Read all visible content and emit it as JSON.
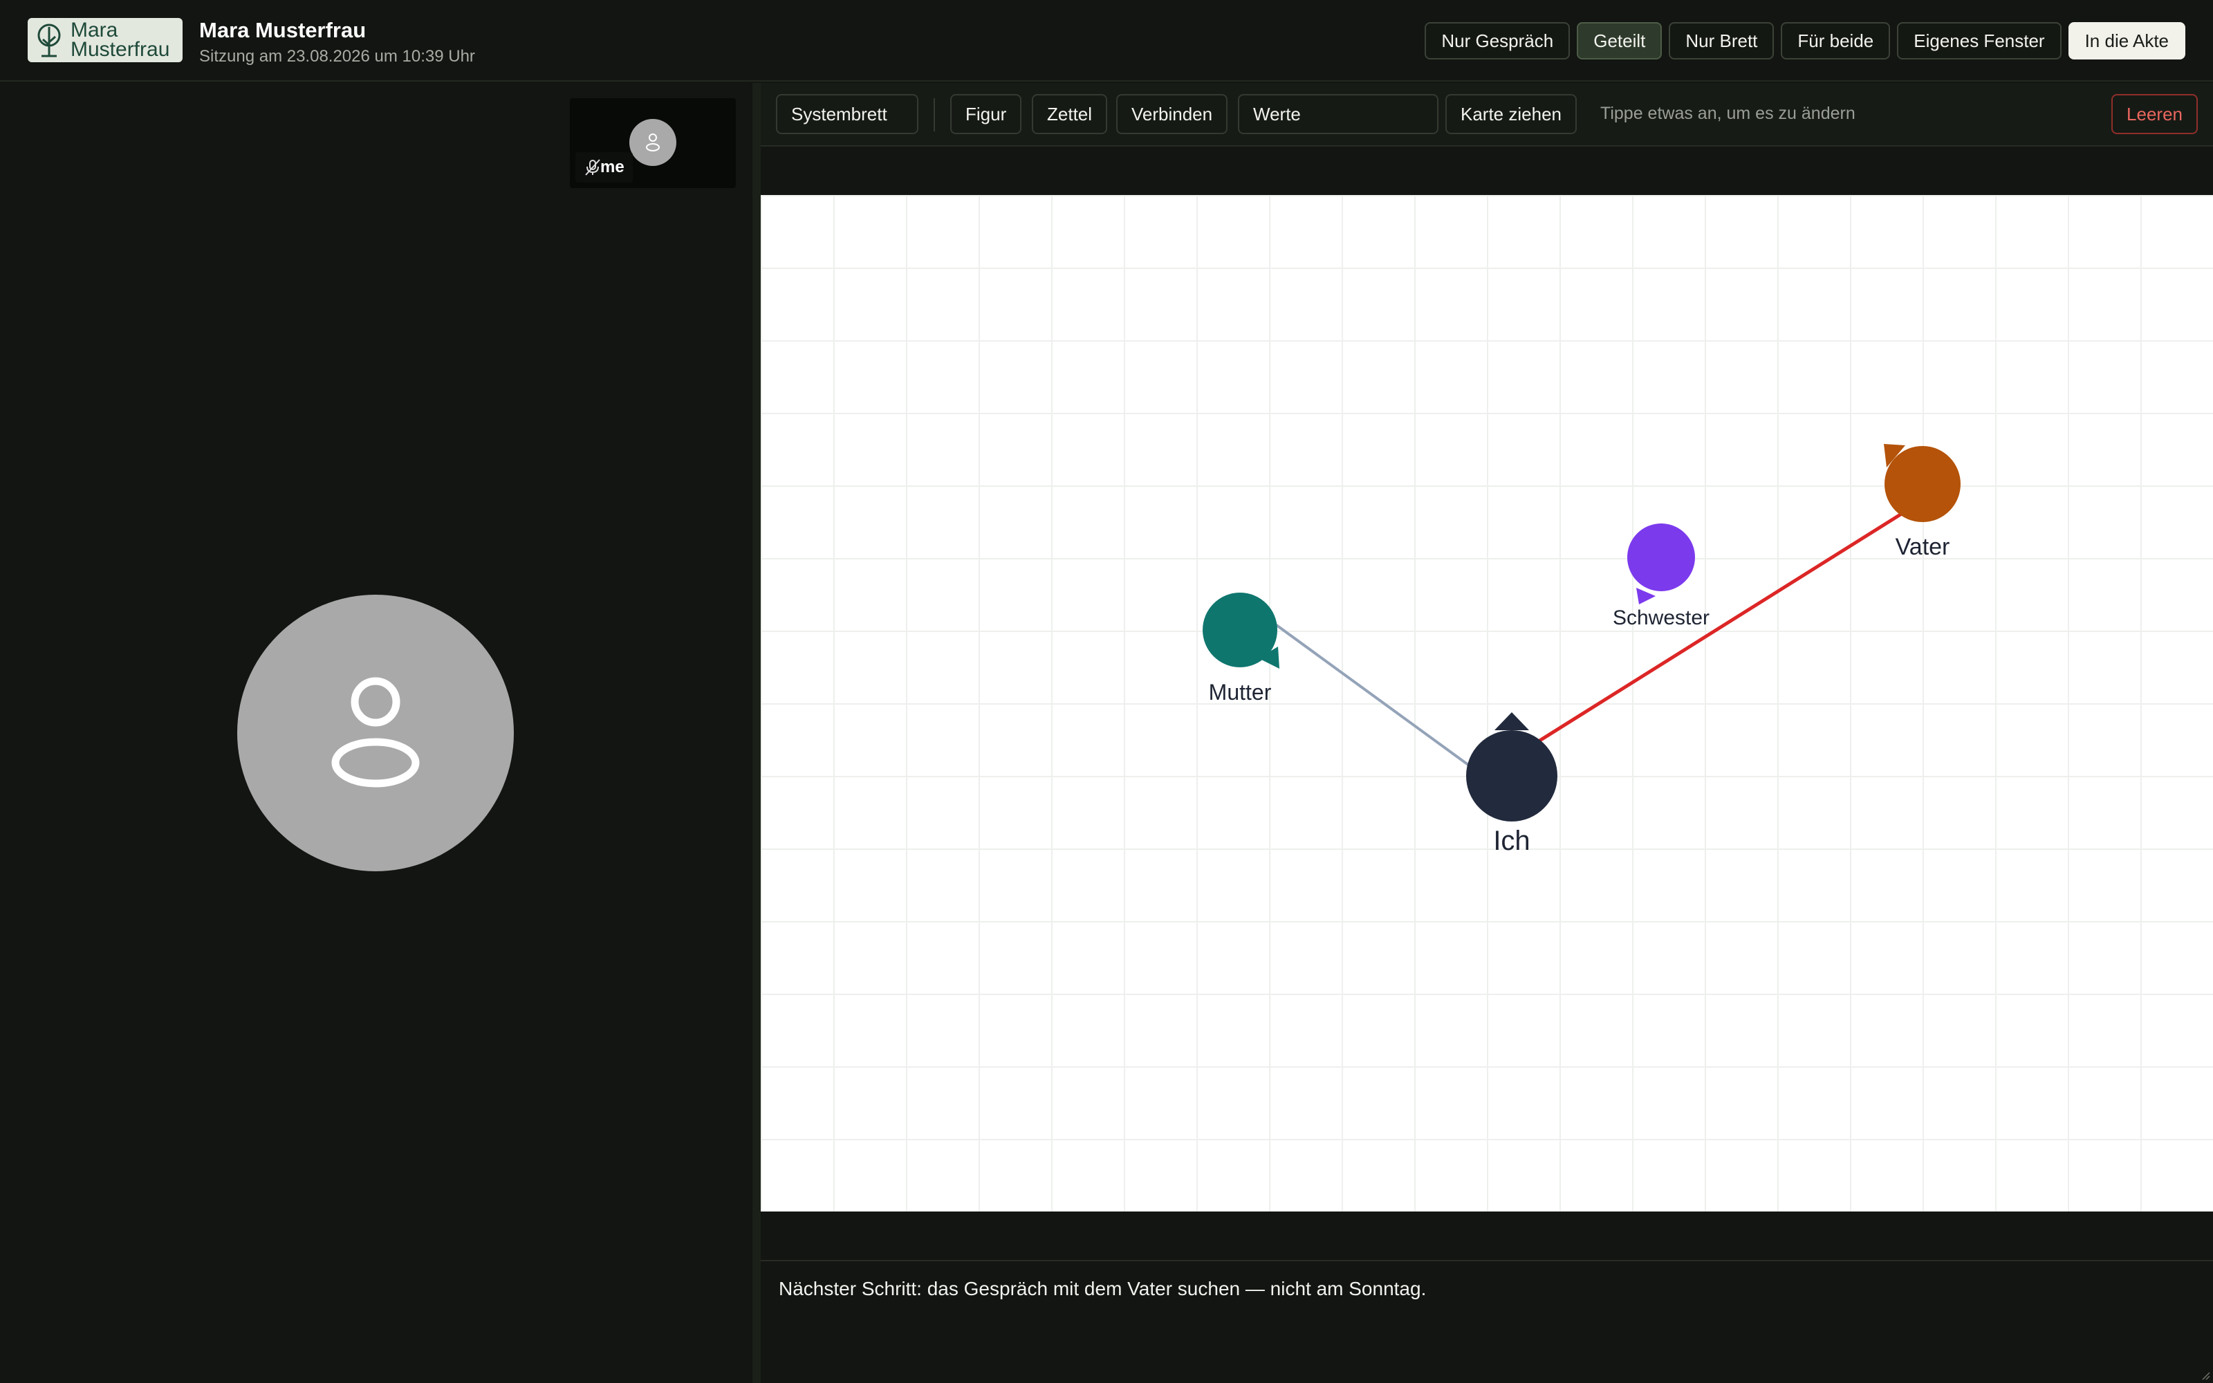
{
  "header": {
    "logo_text_line1": "Mara",
    "logo_text_line2": "Musterfrau",
    "title": "Mara Musterfrau",
    "subtitle": "Sitzung am 23.08.2026 um 10:39 Uhr",
    "view_buttons": [
      "Nur Gespräch",
      "Geteilt",
      "Nur Brett",
      "Für beide",
      "Eigenes Fenster",
      "In die Akte"
    ],
    "active_view": "Geteilt"
  },
  "video": {
    "self_label": "me",
    "self_muted": true
  },
  "toolbar": {
    "mode": "Systembrett",
    "figur": "Figur",
    "zettel": "Zettel",
    "verbinden": "Verbinden",
    "werte_placeholder": "Werte",
    "karte": "Karte ziehen",
    "hint": "Tippe etwas an, um es zu ändern",
    "clear": "Leeren"
  },
  "board": {
    "figures": [
      {
        "id": "ich",
        "label": "Ich",
        "color": "#222a3d"
      },
      {
        "id": "mutter",
        "label": "Mutter",
        "color": "#0f766e"
      },
      {
        "id": "schwester",
        "label": "Schwester",
        "color": "#7c3aed"
      },
      {
        "id": "vater",
        "label": "Vater",
        "color": "#b45309"
      }
    ],
    "connections": [
      {
        "from": "ich",
        "to": "mutter",
        "color": "#94a3b8"
      },
      {
        "from": "ich",
        "to": "vater",
        "color": "#dc2626"
      }
    ]
  },
  "notes": {
    "text": "Nächster Schritt: das Gespräch mit dem Vater suchen — nicht am Sonntag."
  },
  "colors": {
    "background": "#121511",
    "primary_button": "#f2f1ea",
    "danger": "#e8675e"
  }
}
